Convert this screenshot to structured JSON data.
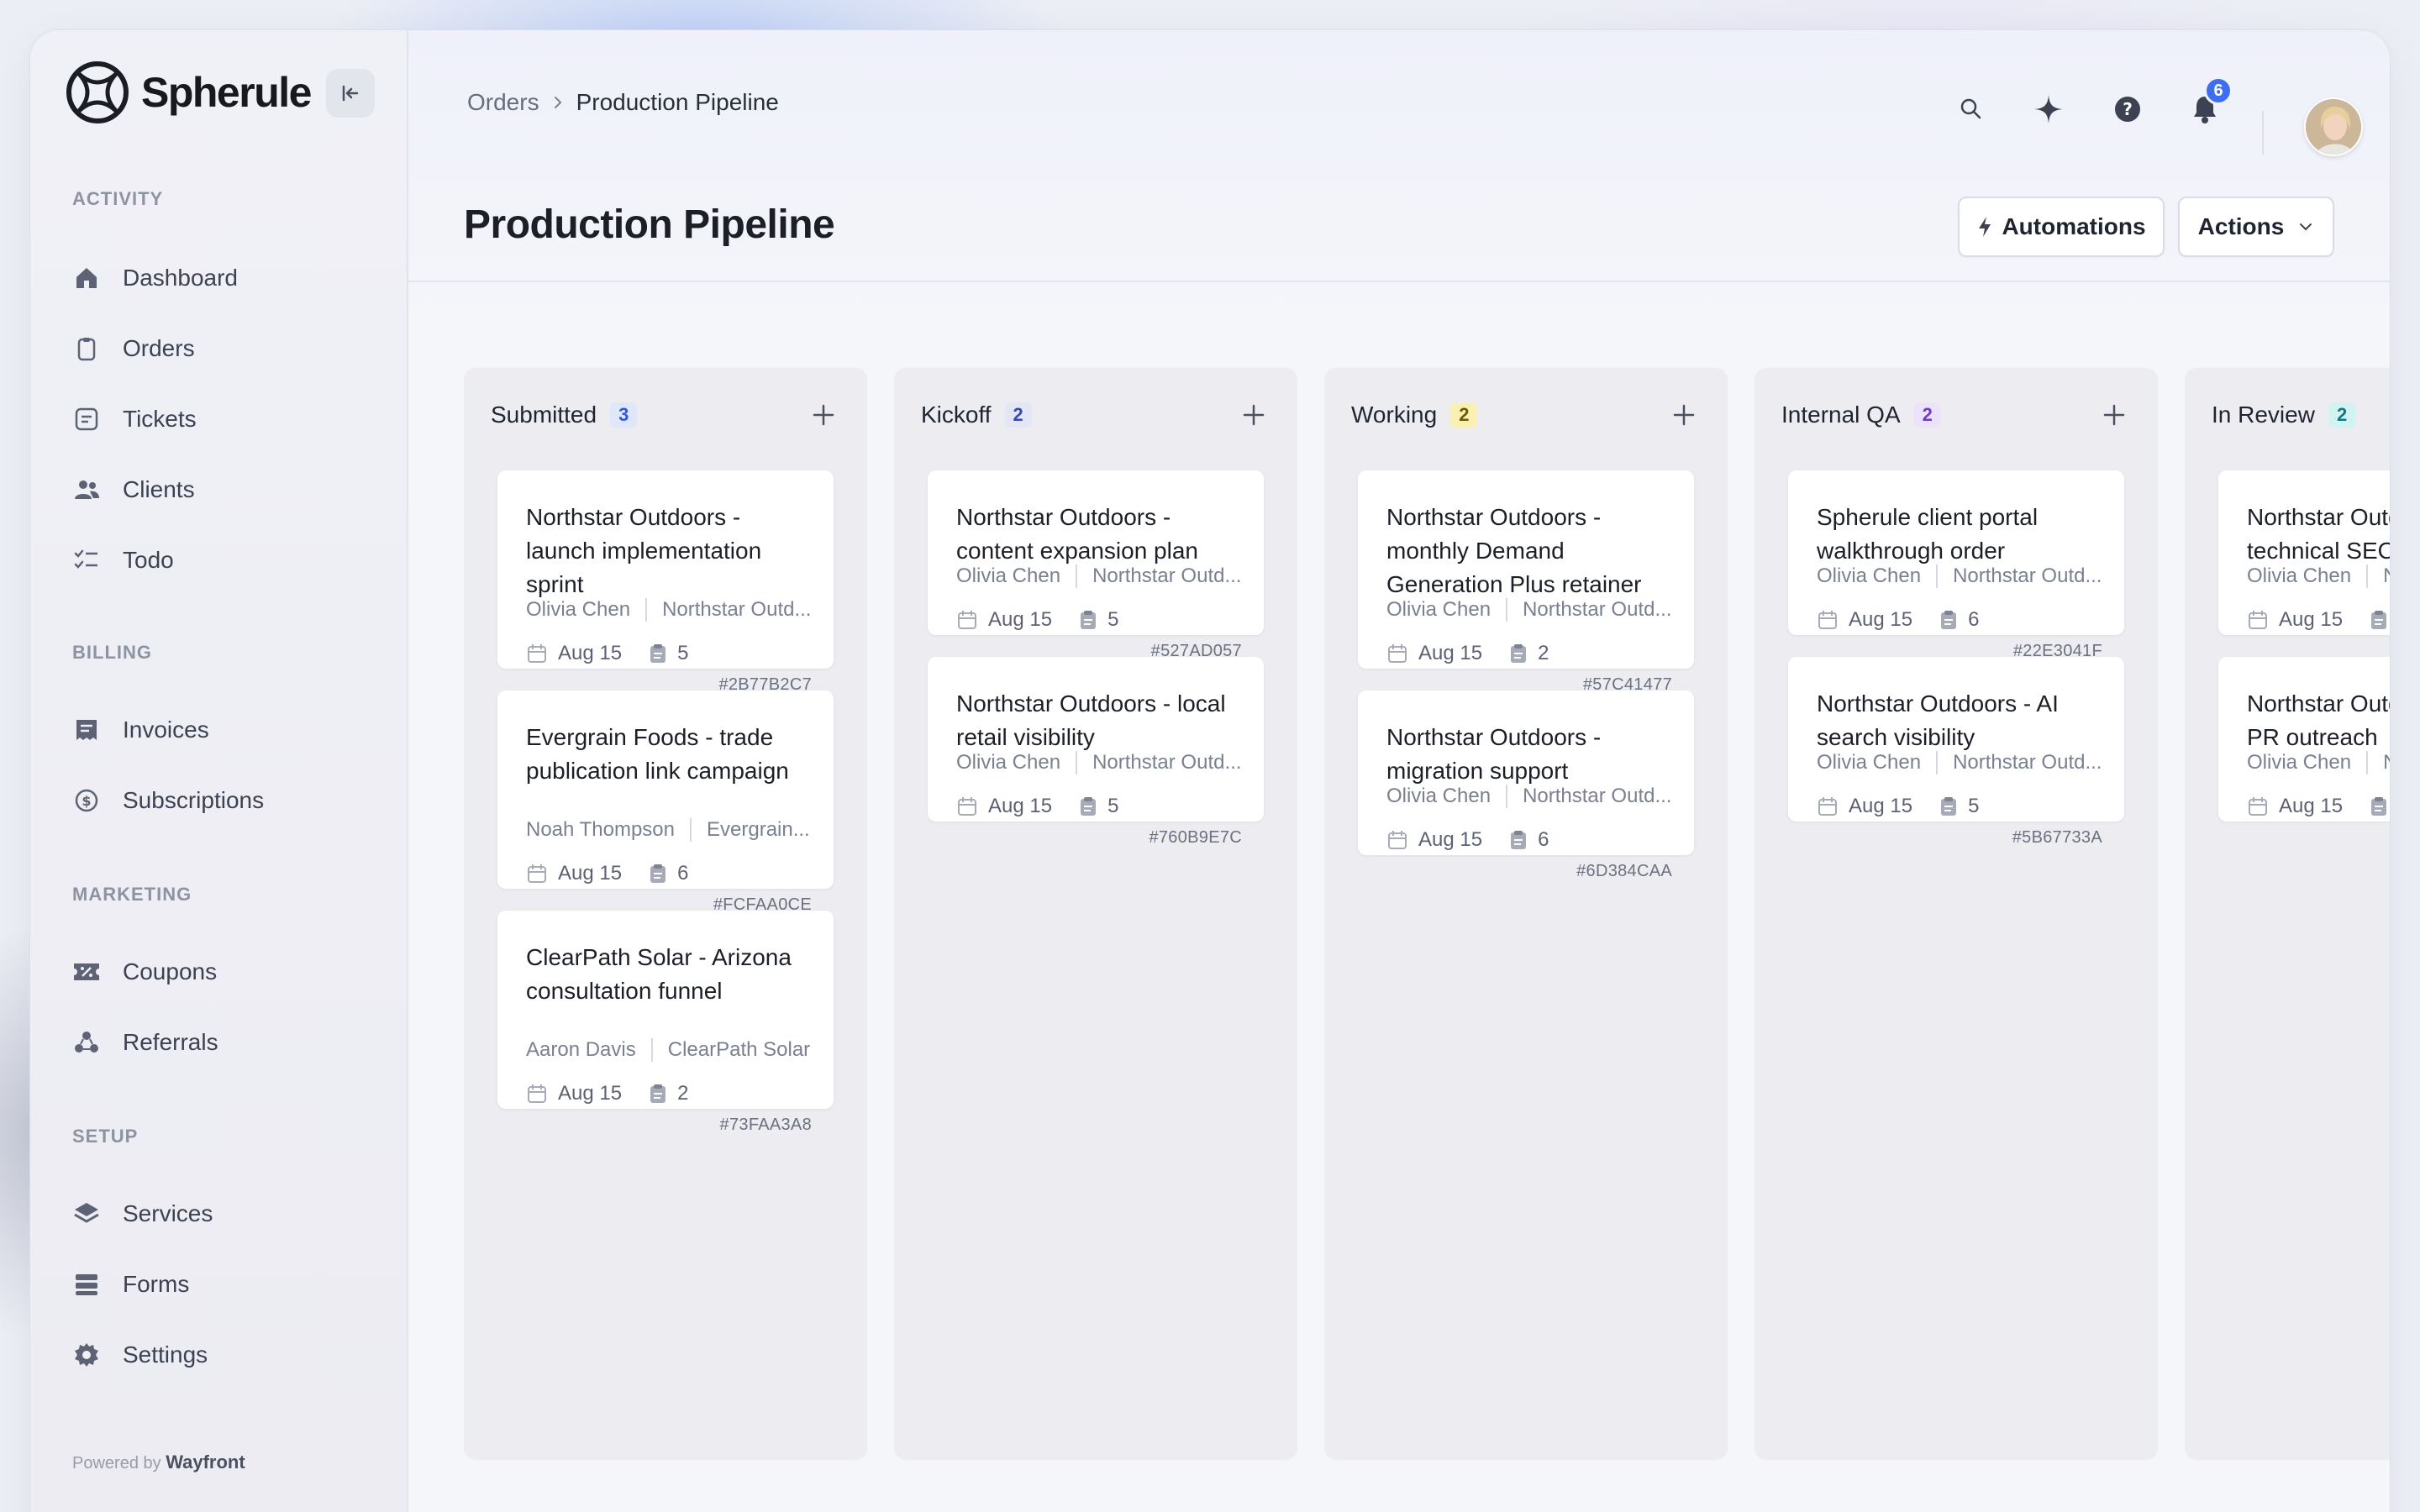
{
  "app": {
    "name": "Spherule"
  },
  "sidebar": {
    "sections": [
      {
        "title": "ACTIVITY",
        "items": [
          {
            "label": "Dashboard",
            "icon": "home-icon"
          },
          {
            "label": "Orders",
            "icon": "clipboard-icon"
          },
          {
            "label": "Tickets",
            "icon": "ticket-icon"
          },
          {
            "label": "Clients",
            "icon": "users-icon"
          },
          {
            "label": "Todo",
            "icon": "checklist-icon"
          }
        ]
      },
      {
        "title": "BILLING",
        "items": [
          {
            "label": "Invoices",
            "icon": "invoice-icon"
          },
          {
            "label": "Subscriptions",
            "icon": "subscription-icon"
          }
        ]
      },
      {
        "title": "MARKETING",
        "items": [
          {
            "label": "Coupons",
            "icon": "coupon-icon"
          },
          {
            "label": "Referrals",
            "icon": "referral-icon"
          }
        ]
      },
      {
        "title": "SETUP",
        "items": [
          {
            "label": "Services",
            "icon": "layers-icon"
          },
          {
            "label": "Forms",
            "icon": "forms-icon"
          },
          {
            "label": "Settings",
            "icon": "gear-icon"
          }
        ]
      }
    ],
    "powered_by": "Powered by",
    "powered_brand": "Wayfront"
  },
  "breadcrumb": {
    "parent": "Orders",
    "current": "Production Pipeline"
  },
  "header": {
    "title": "Production Pipeline",
    "automations_label": "Automations",
    "actions_label": "Actions",
    "notification_count": "6"
  },
  "colors": {
    "accent": "#3f6ff0",
    "submitted_badge_bg": "#dfe7fb",
    "submitted_badge_fg": "#3358d4",
    "kickoff_badge_bg": "#e3e6f4",
    "kickoff_badge_fg": "#3a4aa8",
    "working_badge_bg": "#fbf0b4",
    "working_badge_fg": "#6b5a06",
    "qa_badge_bg": "#ece3fb",
    "qa_badge_fg": "#6b3fc0",
    "review_badge_bg": "#d3f3f3",
    "review_badge_fg": "#0f7c80"
  },
  "columns": [
    {
      "name": "Submitted",
      "count": "3",
      "cards": [
        {
          "title": "Northstar Outdoors - launch implementation sprint",
          "assignee": "Olivia Chen",
          "client": "Northstar Outd...",
          "date": "Aug 15",
          "tasks": "5",
          "id": "#2B77B2C7"
        },
        {
          "title": "Evergrain Foods - trade publication link campaign",
          "assignee": "Noah Thompson",
          "client": "Evergrain...",
          "date": "Aug 15",
          "tasks": "6",
          "id": "#FCFAA0CE"
        },
        {
          "title": "ClearPath Solar - Arizona consultation funnel",
          "assignee": "Aaron Davis",
          "client": "ClearPath Solar",
          "date": "Aug 15",
          "tasks": "2",
          "id": "#73FAA3A8"
        }
      ]
    },
    {
      "name": "Kickoff",
      "count": "2",
      "cards": [
        {
          "title": "Northstar Outdoors - content expansion plan",
          "assignee": "Olivia Chen",
          "client": "Northstar Outd...",
          "date": "Aug 15",
          "tasks": "5",
          "id": "#527AD057"
        },
        {
          "title": "Northstar Outdoors - local retail visibility",
          "assignee": "Olivia Chen",
          "client": "Northstar Outd...",
          "date": "Aug 15",
          "tasks": "5",
          "id": "#760B9E7C"
        }
      ]
    },
    {
      "name": "Working",
      "count": "2",
      "cards": [
        {
          "title": "Northstar Outdoors - monthly Demand Generation Plus retainer",
          "assignee": "Olivia Chen",
          "client": "Northstar Outd...",
          "date": "Aug 15",
          "tasks": "2",
          "id": "#57C41477"
        },
        {
          "title": "Northstar Outdoors - migration support",
          "assignee": "Olivia Chen",
          "client": "Northstar Outd...",
          "date": "Aug 15",
          "tasks": "6",
          "id": "#6D384CAA"
        }
      ]
    },
    {
      "name": "Internal QA",
      "count": "2",
      "cards": [
        {
          "title": "Spherule client portal walkthrough order",
          "assignee": "Olivia Chen",
          "client": "Northstar Outd...",
          "date": "Aug 15",
          "tasks": "6",
          "id": "#22E3041F"
        },
        {
          "title": "Northstar Outdoors - AI search visibility",
          "assignee": "Olivia Chen",
          "client": "Northstar Outd...",
          "date": "Aug 15",
          "tasks": "5",
          "id": "#5B67733A"
        }
      ]
    },
    {
      "name": "In Review",
      "count": "2",
      "cards": [
        {
          "title": "Northstar Outdoors - technical SEO",
          "assignee": "Olivia Chen",
          "client": "Northstar Outd...",
          "date": "Aug 15",
          "tasks": "",
          "id": ""
        },
        {
          "title": "Northstar Outdoors - digital PR outreach",
          "assignee": "Olivia Chen",
          "client": "Northstar Outd...",
          "date": "Aug 15",
          "tasks": "",
          "id": ""
        }
      ]
    }
  ]
}
